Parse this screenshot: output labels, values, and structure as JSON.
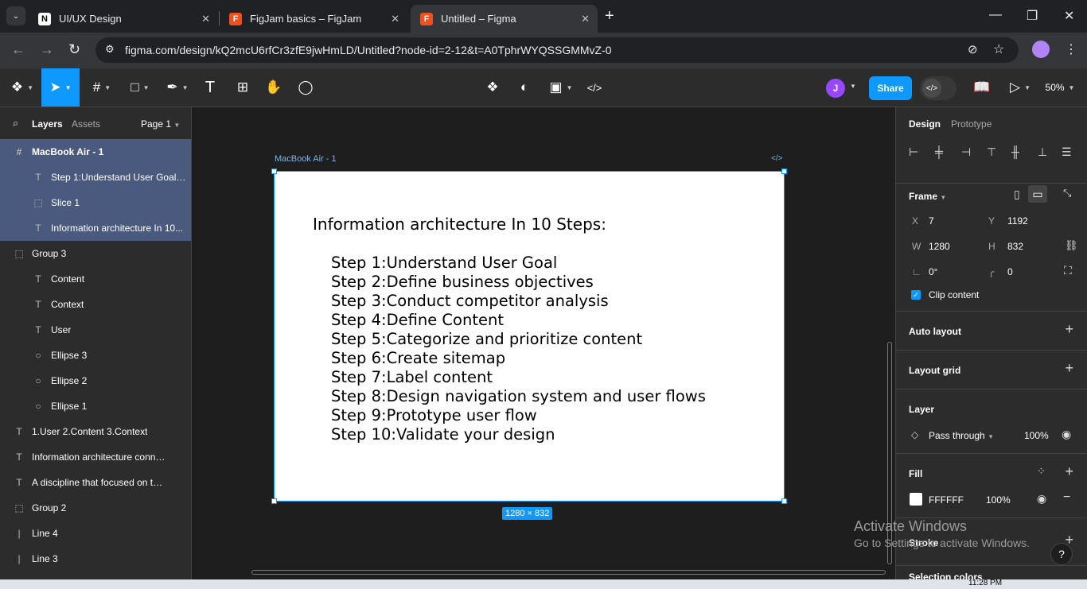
{
  "browser": {
    "tabs": [
      {
        "title": "UI/UX Design",
        "icon": "notion-icon"
      },
      {
        "title": "FigJam basics – FigJam",
        "icon": "figma-icon"
      },
      {
        "title": "Untitled – Figma",
        "icon": "figma-icon",
        "active": true
      }
    ],
    "url": "figma.com/design/kQ2mcU6rfCr3zfE9jwHmLD/Untitled?node-id=2-12&t=A0TphrWYQSSGMMvZ-0"
  },
  "toolbar": {
    "avatar_initial": "J",
    "share_label": "Share",
    "zoom": "50%",
    "accent": "#0d99ff"
  },
  "left_panel": {
    "tab_layers": "Layers",
    "tab_assets": "Assets",
    "page": "Page 1",
    "layers": [
      {
        "name": "MacBook Air - 1",
        "icon": "#",
        "indent": 0,
        "selected": "top"
      },
      {
        "name": "Step 1:Understand User Goal ...",
        "icon": "T",
        "indent": 1,
        "selected": "child"
      },
      {
        "name": "Slice 1",
        "icon": "⬚",
        "indent": 1,
        "selected": "child"
      },
      {
        "name": "Information architecture In 10...",
        "icon": "T",
        "indent": 1,
        "selected": "child"
      },
      {
        "name": "Group 3",
        "icon": "⬚",
        "indent": 0
      },
      {
        "name": "Content",
        "icon": "T",
        "indent": 1
      },
      {
        "name": "Context",
        "icon": "T",
        "indent": 1
      },
      {
        "name": "User",
        "icon": "T",
        "indent": 1
      },
      {
        "name": "Ellipse 3",
        "icon": "○",
        "indent": 1
      },
      {
        "name": "Ellipse 2",
        "icon": "○",
        "indent": 1
      },
      {
        "name": "Ellipse 1",
        "icon": "○",
        "indent": 1
      },
      {
        "name": "1.User 2.Content 3.Context",
        "icon": "T",
        "indent": 0
      },
      {
        "name": "Information architecture connects ...",
        "icon": "T",
        "indent": 0
      },
      {
        "name": "A discipline that focused on the or...",
        "icon": "T",
        "indent": 0
      },
      {
        "name": "Group 2",
        "icon": "⬚",
        "indent": 0
      },
      {
        "name": "Line 4",
        "icon": "|",
        "indent": 0
      },
      {
        "name": "Line 3",
        "icon": "|",
        "indent": 0
      }
    ]
  },
  "canvas": {
    "frame_label": "MacBook Air - 1",
    "size_badge": "1280 × 832",
    "heading": "Information architecture In 10 Steps:",
    "steps": [
      "Step 1:Understand User Goal",
      "Step 2:Define business objectives",
      "Step 3:Conduct competitor analysis",
      "Step 4:Define Content",
      "Step 5:Categorize and prioritize content",
      "Step 6:Create sitemap",
      "Step 7:Label content",
      "Step 8:Design navigation system and user flows",
      "Step 9:Prototype user flow",
      "Step 10:Validate your design"
    ]
  },
  "right_panel": {
    "tab_design": "Design",
    "tab_prototype": "Prototype",
    "frame": {
      "title": "Frame",
      "x_label": "X",
      "x": "7",
      "y_label": "Y",
      "y": "1192",
      "w_label": "W",
      "w": "1280",
      "h_label": "H",
      "h": "832",
      "rotation": "0°",
      "radius": "0",
      "clip_content": "Clip content"
    },
    "auto_layout": "Auto layout",
    "layout_grid": "Layout grid",
    "layer": {
      "title": "Layer",
      "blend": "Pass through",
      "opacity": "100%"
    },
    "fill": {
      "title": "Fill",
      "hex": "FFFFFF",
      "opacity": "100%"
    },
    "stroke": "Stroke",
    "selection_colors": "Selection colors"
  },
  "watermark": {
    "line1": "Activate Windows",
    "line2": "Go to Settings to activate Windows."
  },
  "taskbar": {
    "time": "11:28 PM"
  }
}
